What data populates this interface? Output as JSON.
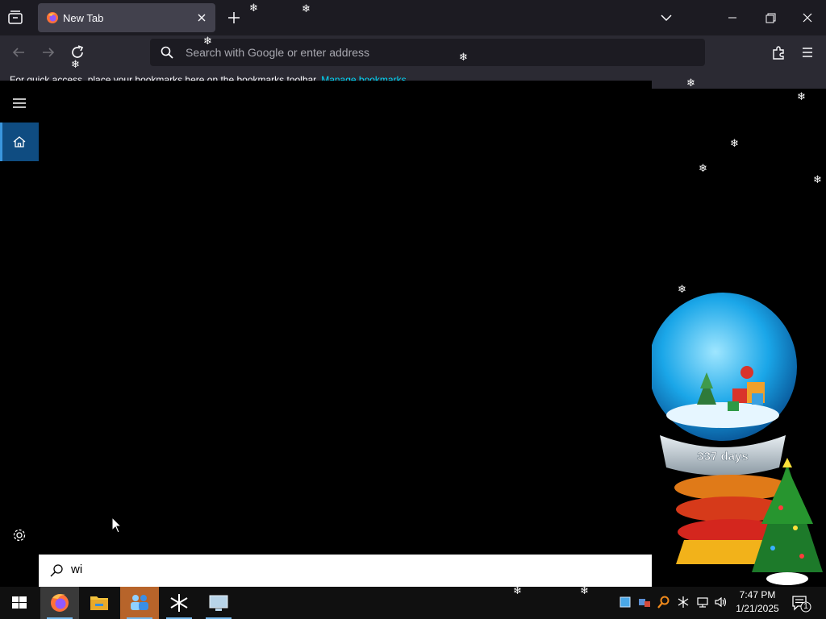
{
  "browser": {
    "tab": {
      "title": "New Tab"
    },
    "urlbar": {
      "placeholder": "Search with Google or enter address"
    },
    "bookmarks_bar": {
      "text": "For quick access, place your bookmarks here on the bookmarks toolbar.",
      "link": "Manage bookmarks"
    }
  },
  "start_menu": {
    "search": {
      "value": "wi"
    }
  },
  "desktop": {
    "widget_text": "337 days"
  },
  "taskbar": {
    "clock": {
      "time": "7:47 PM",
      "date": "1/21/2025"
    },
    "notification_count": "1"
  },
  "colors": {
    "chrome_dark": "#1c1b22",
    "toolbar": "#2b2a33",
    "accent_link": "#00ddff",
    "start_home_highlight": "#0f4c81",
    "taskbar_highlight": "#b7642a"
  },
  "icons": [
    "tab-list-icon",
    "firefox-icon",
    "close-icon",
    "plus-icon",
    "chevron-down-icon",
    "minimize-icon",
    "restore-icon",
    "back-arrow-icon",
    "forward-arrow-icon",
    "reload-icon",
    "search-icon",
    "extensions-icon",
    "hamburger-menu-icon",
    "home-icon",
    "settings-gear-icon",
    "windows-logo-icon",
    "file-explorer-icon",
    "snow-globe-icon"
  ]
}
